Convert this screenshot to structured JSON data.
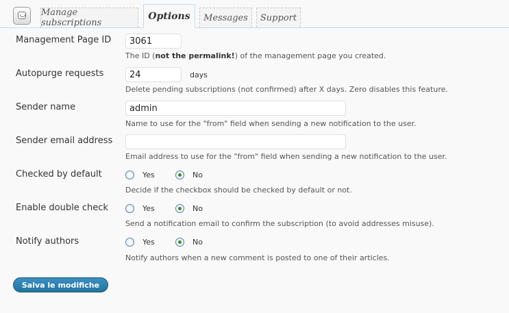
{
  "tabs": [
    {
      "label": "Manage subscriptions"
    },
    {
      "label": "Options"
    },
    {
      "label": "Messages"
    },
    {
      "label": "Support"
    }
  ],
  "fields": {
    "management_page_id": {
      "label": "Management Page ID",
      "value": "3061",
      "desc_prefix": "The ID (",
      "desc_bold": "not the permalink!",
      "desc_suffix": ") of the management page you created."
    },
    "autopurge": {
      "label": "Autopurge requests",
      "value": "24",
      "unit": "days",
      "desc": "Delete pending subscriptions (not confirmed) after X days. Zero disables this feature."
    },
    "sender_name": {
      "label": "Sender name",
      "value": "admin",
      "desc": "Name to use for the \"from\" field when sending a new notification to the user."
    },
    "sender_email": {
      "label": "Sender email address",
      "desc": "Email address to use for the \"from\" field when sending a new notification to the user."
    },
    "checked_default": {
      "label": "Checked by default",
      "yes": "Yes",
      "no": "No",
      "selected": "No",
      "desc": "Decide if the checkbox should be checked by default or not."
    },
    "double_check": {
      "label": "Enable double check",
      "yes": "Yes",
      "no": "No",
      "selected": "No",
      "desc": "Send a notification email to confirm the subscription (to avoid addresses misuse)."
    },
    "notify_authors": {
      "label": "Notify authors",
      "yes": "Yes",
      "no": "No",
      "selected": "No",
      "desc": "Notify authors when a new comment is posted to one of their articles."
    }
  },
  "save_button": "Salva le modifiche"
}
